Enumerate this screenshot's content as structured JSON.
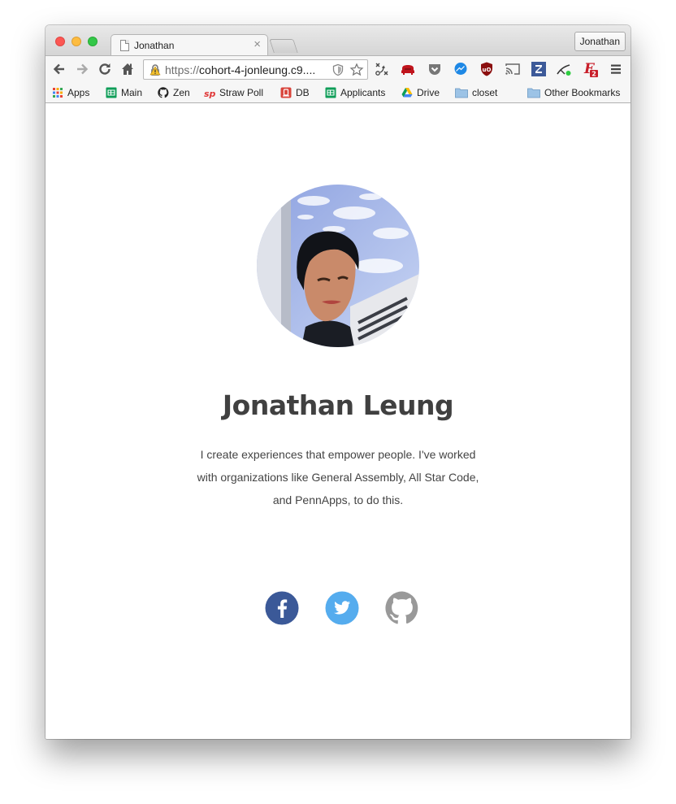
{
  "browser": {
    "tab_title": "Jonathan",
    "tab_close": "×",
    "profile_name": "Jonathan",
    "url_scheme": "https://",
    "url_rest": "cohort-4-jonleung.c9....",
    "toolbar_icons": [
      "back-icon",
      "forward-icon",
      "reload-icon",
      "home-icon"
    ],
    "extensions": [
      "shortcut-icon",
      "pocket-sofa-icon",
      "pocket-icon",
      "messenger-icon",
      "ublock-icon",
      "cast-icon",
      "zotero-icon",
      "stylus-icon",
      "extension-badge-icon",
      "menu-icon"
    ],
    "extension_badge_count": "2"
  },
  "bookmarks": {
    "items": [
      {
        "label": "Apps",
        "icon": "apps-grid-icon"
      },
      {
        "label": "Main",
        "icon": "sheets-icon"
      },
      {
        "label": "Zen",
        "icon": "github-icon"
      },
      {
        "label": "Straw Poll",
        "icon": "strawpoll-icon"
      },
      {
        "label": "DB",
        "icon": "db-icon"
      },
      {
        "label": "Applicants",
        "icon": "sheets-icon"
      },
      {
        "label": "Drive",
        "icon": "drive-icon"
      },
      {
        "label": "closet",
        "icon": "folder-icon"
      }
    ],
    "other_label": "Other Bookmarks"
  },
  "profile": {
    "name": "Jonathan Leung",
    "bio": "I create experiences that empower people. I've worked with organizations like General Assembly, All Star Code, and PennApps, to do this.",
    "social": [
      {
        "name": "facebook",
        "icon": "facebook-icon",
        "color": "#3b5998"
      },
      {
        "name": "twitter",
        "icon": "twitter-icon",
        "color": "#55acee"
      },
      {
        "name": "github",
        "icon": "github-icon",
        "color": "#999999"
      }
    ]
  }
}
